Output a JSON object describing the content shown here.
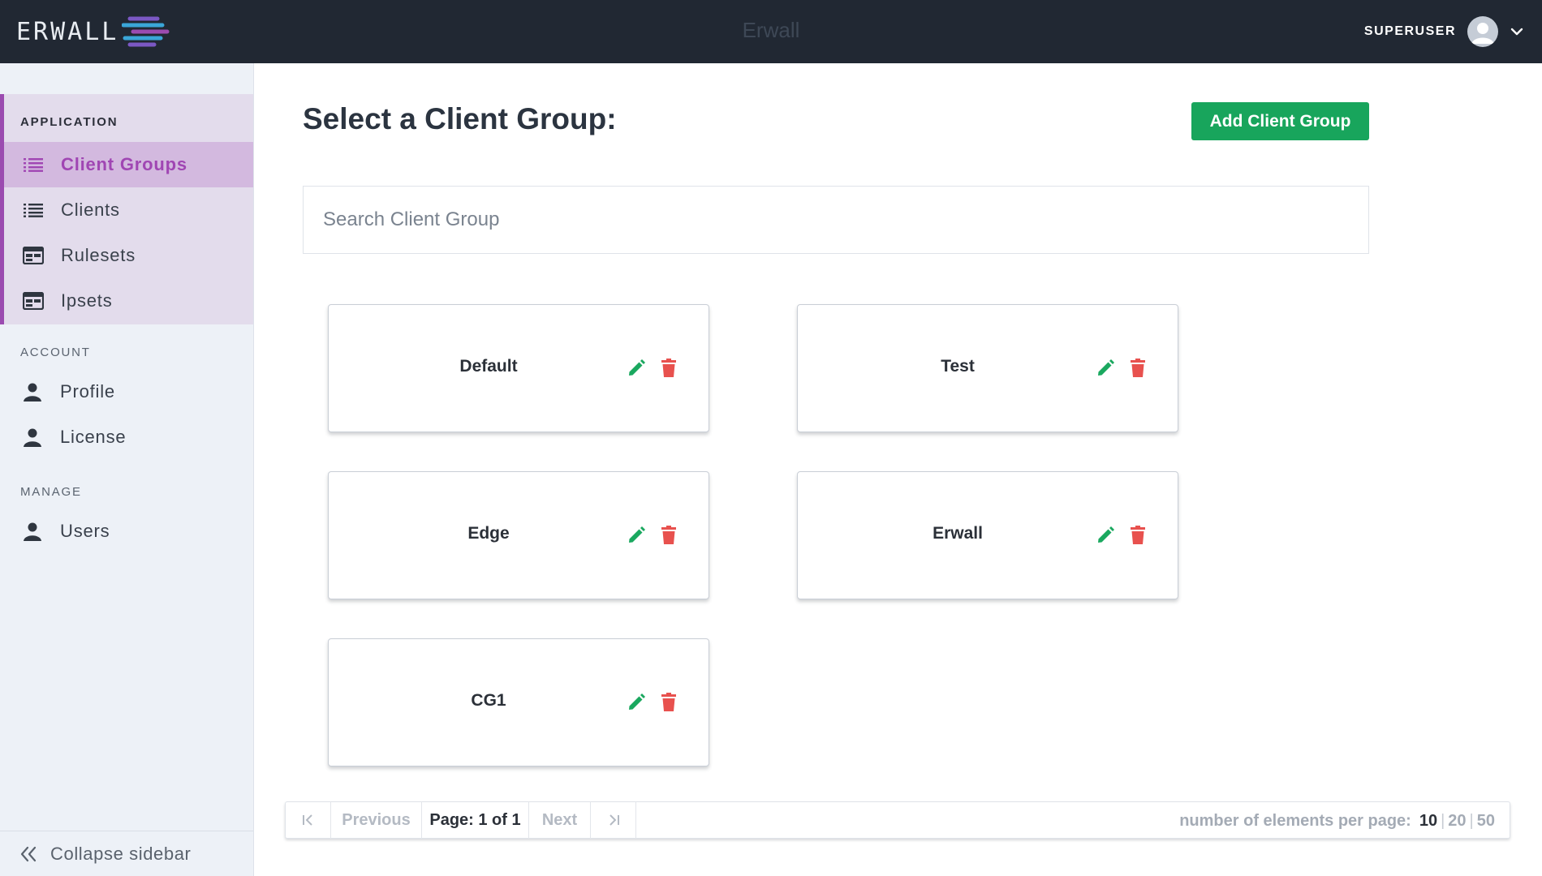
{
  "header": {
    "logo_text": "ERWALL",
    "app_title": "Erwall",
    "username": "SUPERUSER"
  },
  "sidebar": {
    "sections": {
      "application": "APPLICATION",
      "account": "ACCOUNT",
      "manage": "MANAGE"
    },
    "items": [
      {
        "label": "Client Groups",
        "icon": "list-icon",
        "active": true
      },
      {
        "label": "Clients",
        "icon": "list-icon"
      },
      {
        "label": "Rulesets",
        "icon": "table-icon"
      },
      {
        "label": "Ipsets",
        "icon": "table-icon"
      },
      {
        "label": "Profile",
        "icon": "user-icon"
      },
      {
        "label": "License",
        "icon": "user-icon"
      },
      {
        "label": "Users",
        "icon": "user-icon"
      }
    ],
    "collapse_label": "Collapse sidebar"
  },
  "main": {
    "title": "Select a Client Group:",
    "add_button": "Add Client Group",
    "search_placeholder": "Search Client Group",
    "groups": [
      "Default",
      "Test",
      "Edge",
      "Erwall",
      "CG1"
    ]
  },
  "pagination": {
    "previous": "Previous",
    "page_label": "Page: 1 of 1",
    "next": "Next",
    "per_page_label": "number of elements per page:",
    "per_page_options": [
      "10",
      "20",
      "50"
    ],
    "per_page_selected": "10"
  },
  "colors": {
    "topbar": "#212833",
    "accent": "#9b4bb0",
    "success": "#18a55c",
    "edit": "#1aa85f",
    "delete": "#e8514e"
  }
}
